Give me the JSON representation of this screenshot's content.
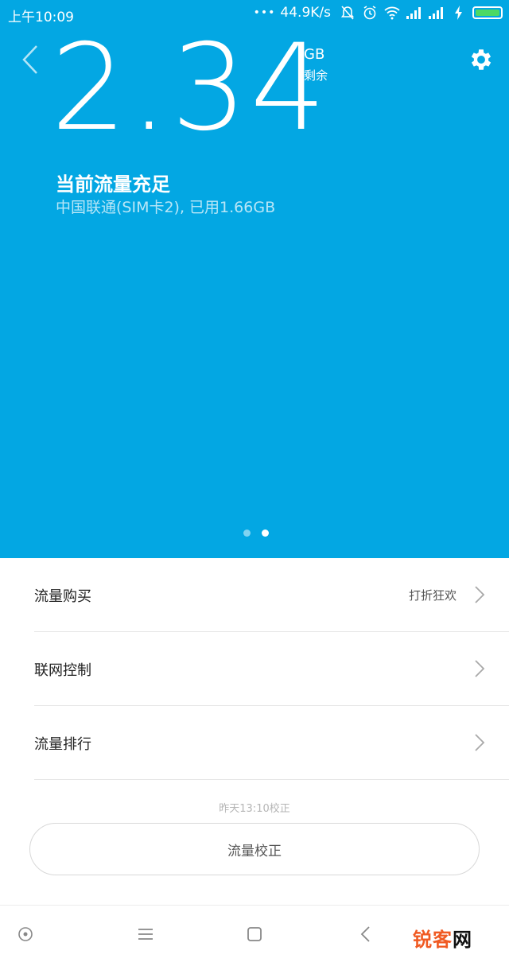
{
  "statusbar": {
    "time": "上午10:09",
    "dots": "•••",
    "speed": "44.9K/s",
    "icons": [
      "mute-bell-icon",
      "alarm-icon",
      "wifi-icon",
      "signal-icon",
      "signal-icon",
      "charging-icon",
      "battery-icon"
    ]
  },
  "hero": {
    "remaining_value": "2.34",
    "remaining_unit": "GB",
    "remaining_label": "剩余",
    "status_title": "当前流量充足",
    "status_detail": "中国联通(SIM卡2), 已用1.66GB",
    "page_count": 2,
    "active_page": 2,
    "background_color": "#03a7e3"
  },
  "menu": {
    "items": [
      {
        "label": "流量购买",
        "extra": "打折狂欢"
      },
      {
        "label": "联网控制",
        "extra": ""
      },
      {
        "label": "流量排行",
        "extra": ""
      }
    ]
  },
  "calibration": {
    "last_time": "昨天13:10校正",
    "button_label": "流量校正"
  },
  "navbar": {
    "icons": [
      "circle-dot-icon",
      "menu-icon",
      "home-square-icon",
      "back-icon"
    ]
  },
  "watermark": {
    "part1": "锐客",
    "part2": "网"
  }
}
